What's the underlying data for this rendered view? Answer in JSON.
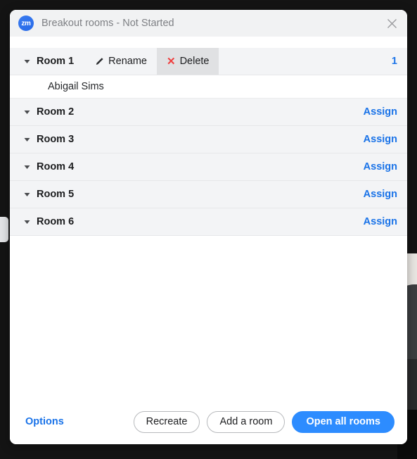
{
  "window": {
    "logo_text": "zm",
    "logo_icon": "zoom-logo-icon",
    "title": "Breakout rooms - Not Started",
    "close_icon": "close-icon"
  },
  "rooms": [
    {
      "caret_icon": "chevron-down-icon",
      "name": "Room 1",
      "expanded": true,
      "rename_label": "Rename",
      "rename_icon": "pencil-icon",
      "delete_label": "Delete",
      "delete_icon": "red-x-icon",
      "delete_hovered": true,
      "count": "1",
      "participants": [
        "Abigail Sims"
      ]
    },
    {
      "caret_icon": "chevron-down-icon",
      "name": "Room 2",
      "expanded": false,
      "assign_label": "Assign",
      "participants": []
    },
    {
      "caret_icon": "chevron-down-icon",
      "name": "Room 3",
      "expanded": false,
      "assign_label": "Assign",
      "participants": []
    },
    {
      "caret_icon": "chevron-down-icon",
      "name": "Room 4",
      "expanded": false,
      "assign_label": "Assign",
      "participants": []
    },
    {
      "caret_icon": "chevron-down-icon",
      "name": "Room 5",
      "expanded": false,
      "assign_label": "Assign",
      "participants": []
    },
    {
      "caret_icon": "chevron-down-icon",
      "name": "Room 6",
      "expanded": false,
      "assign_label": "Assign",
      "participants": []
    }
  ],
  "footer": {
    "options_label": "Options",
    "recreate_label": "Recreate",
    "add_room_label": "Add a room",
    "open_all_label": "Open all rooms"
  },
  "colors": {
    "accent_blue": "#1a73e8",
    "primary_button": "#2d8cff",
    "delete_red": "#ef3e3e",
    "row_background": "#f3f4f6",
    "titlebar_background": "#f1f2f3"
  }
}
